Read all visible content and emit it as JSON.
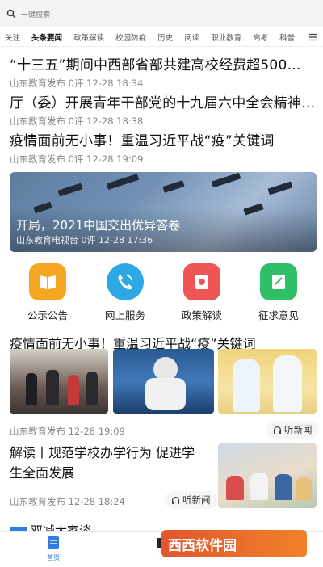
{
  "search": {
    "placeholder": "一键搜索"
  },
  "tabs": [
    {
      "label": "关注"
    },
    {
      "label": "头条要闻"
    },
    {
      "label": "政策解读"
    },
    {
      "label": "校园防疫"
    },
    {
      "label": "历史"
    },
    {
      "label": "阅读"
    },
    {
      "label": "职业教育"
    },
    {
      "label": "高考"
    },
    {
      "label": "科普"
    }
  ],
  "news": [
    {
      "title": "“十三五”期间中西部省部共建高校经费超500…",
      "meta": "山东教育发布 0评 12-28 18:34"
    },
    {
      "title": "厅（委）开展青年干部党的十九届六中全会精神…",
      "meta": "山东教育发布 0评 12-28 18:38"
    },
    {
      "title": "疫情面前无小事！重温习近平战“疫”关键词",
      "meta": "山东教育发布 0评 12-28 19:09"
    }
  ],
  "banner": {
    "title": "开局，2021中国交出优异答卷",
    "meta": "山东教育电视台 0评 12-28 17:36"
  },
  "quick_links": [
    {
      "label": "公示公告",
      "icon": "book-icon",
      "color": "#f5a623"
    },
    {
      "label": "网上服务",
      "icon": "phone-icon",
      "color": "#2da8e6"
    },
    {
      "label": "政策解读",
      "icon": "document-icon",
      "color": "#ee5656"
    },
    {
      "label": "征求意见",
      "icon": "edit-icon",
      "color": "#2fbf66"
    }
  ],
  "feature": {
    "title": "疫情面前无小事！重温习近平战“疫”关键词",
    "meta": "山东教育发布 12-28 19:09",
    "listen_label": "听新闻"
  },
  "story": {
    "title": "解读丨规范学校办学行为 促进学生全面发展",
    "meta": "山东教育发布 12-28 18:24",
    "listen_label": "听新闻"
  },
  "partial": {
    "title": "双减大家谈"
  },
  "bottom_nav": {
    "home_label": "首页"
  },
  "watermark": {
    "text": "西西软件园"
  }
}
